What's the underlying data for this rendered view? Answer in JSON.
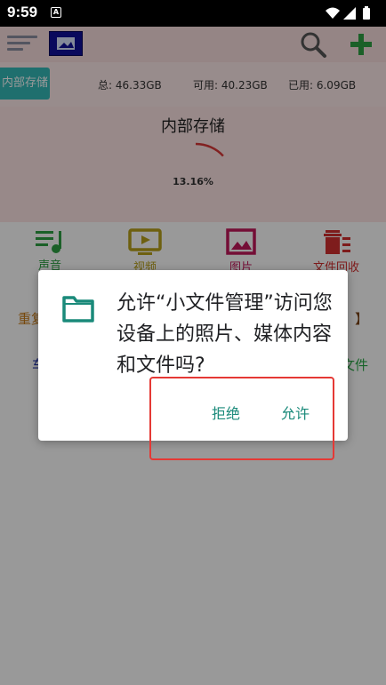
{
  "status_bar": {
    "time": "9:59",
    "app_icon_letter": "A"
  },
  "toolbar": {
    "menu_icon": "menu-lines-icon",
    "thumbnail_icon": "image-thumbnail-icon",
    "search_icon": "search-icon",
    "add_icon": "plus-icon",
    "accent_color": "#2ea043"
  },
  "storage": {
    "tab_label": "内部存储",
    "total": "总: 46.33GB",
    "free": "可用: 40.23GB",
    "used": "已用: 6.09GB"
  },
  "chart": {
    "title": "内部存储",
    "percent_label": "13.16%",
    "used_fraction": 0.1316,
    "arc_color": "#d93838"
  },
  "categories": [
    {
      "label": "声音",
      "icon": "music-note-icon",
      "color": "#2ea043"
    },
    {
      "label": "视频",
      "icon": "video-tv-icon",
      "color": "#b8a01a"
    },
    {
      "label": "图片",
      "icon": "image-icon",
      "color": "#c2185b"
    },
    {
      "label": "文件回收",
      "icon": "trash-icon",
      "color": "#d32f2f"
    }
  ],
  "functions": {
    "row1_left": "重复",
    "row1_right": "】",
    "row2_left": "车",
    "row2_right": "文件"
  },
  "dialog": {
    "icon": "folder-icon",
    "icon_color": "#1a8a7a",
    "message": "允许“小文件管理”访问您设备上的照片、媒体内容和文件吗?",
    "deny_label": "拒绝",
    "allow_label": "允许"
  }
}
